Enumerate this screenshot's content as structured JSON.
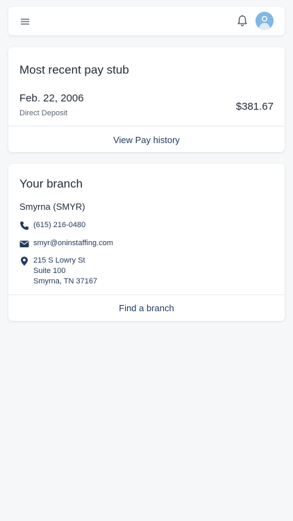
{
  "header": {
    "menu_icon": "hamburger-menu-icon",
    "notification_icon": "bell-icon",
    "avatar_icon": "user-avatar-icon"
  },
  "pay_stub": {
    "title": "Most recent pay stub",
    "date": "Feb. 22, 2006",
    "method": "Direct Deposit",
    "amount": "$381.67",
    "link_label": "View Pay history"
  },
  "branch": {
    "title": "Your branch",
    "name": "Smyrna (SMYR)",
    "phone": "(615) 216-0480",
    "email": "smyr@oninstaffing.com",
    "address_line1": "215 S Lowry St",
    "address_line2": "Suite 100",
    "address_line3": "Smyrna, TN 37167",
    "link_label": "Find a branch"
  },
  "colors": {
    "accent": "#243a5e",
    "background": "#f6f7f9",
    "card": "#ffffff",
    "avatar": "#7fb7e6"
  }
}
